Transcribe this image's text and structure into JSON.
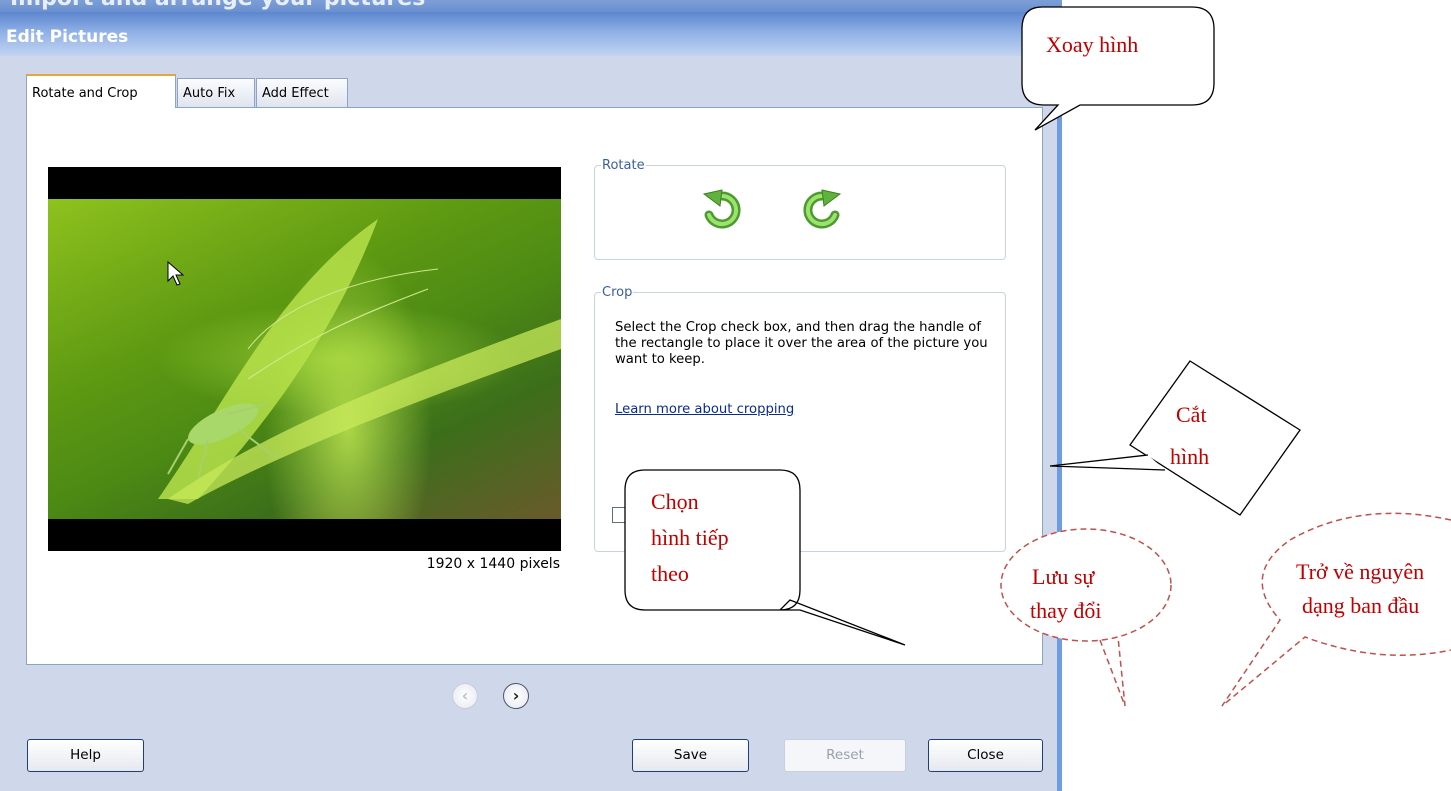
{
  "window": {
    "background_title": "Import and arrange your pictures",
    "title": "Edit Pictures"
  },
  "tabs": [
    {
      "label": "Rotate and Crop",
      "active": true
    },
    {
      "label": "Auto Fix",
      "active": false
    },
    {
      "label": "Add Effect",
      "active": false
    }
  ],
  "preview": {
    "dimensions": "1920 x 1440 pixels"
  },
  "rotate": {
    "legend": "Rotate",
    "left_icon": "rotate-left-icon",
    "right_icon": "rotate-right-icon"
  },
  "crop": {
    "legend": "Crop",
    "description": "Select the Crop check box, and then drag the handle of the rectangle to place it over the area of the picture you want to keep.",
    "link": "Learn more about cropping",
    "checked": false
  },
  "navigation": {
    "prev_icon": "chevron-left-icon",
    "next_icon": "chevron-right-icon"
  },
  "buttons": {
    "help": "Help",
    "save": "Save",
    "reset": "Reset",
    "close": "Close"
  },
  "callouts": {
    "rotate_line1": "Xoay hình",
    "crop_line1": "Cắt",
    "crop_line2": "hình",
    "next_line1": "Chọn",
    "next_line2": "hình tiếp",
    "next_line3": "theo",
    "save_line1": "Lưu sự",
    "save_line2": "thay đổi",
    "reset_line1": "Trở về nguyên",
    "reset_line2": "dạng ban đầu"
  },
  "colors": {
    "callout_text": "#c00000",
    "titlebar": "#5d86cf",
    "rotate_icon": "#5aa93a"
  }
}
